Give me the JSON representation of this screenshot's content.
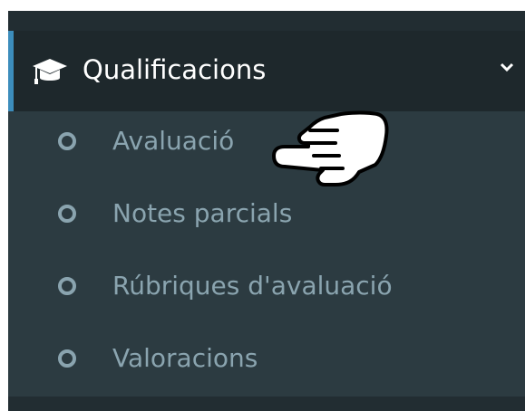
{
  "menu": {
    "title": "Qualificacions",
    "icon": "graduation-cap-icon",
    "expand_icon": "chevron-down-icon",
    "items": [
      {
        "label": "Avaluació",
        "icon": "circle-outline-icon"
      },
      {
        "label": "Notes parcials",
        "icon": "circle-outline-icon"
      },
      {
        "label": "Rúbriques d'avaluació",
        "icon": "circle-outline-icon"
      },
      {
        "label": "Valoracions",
        "icon": "circle-outline-icon"
      }
    ]
  },
  "cursor": {
    "icon": "pointing-hand-cursor-icon"
  },
  "colors": {
    "sidebar_bg": "#2c3b41",
    "header_bg": "#1e282c",
    "accent": "#3c8dbc",
    "item_text": "#8aa4af",
    "header_text": "#ffffff"
  }
}
